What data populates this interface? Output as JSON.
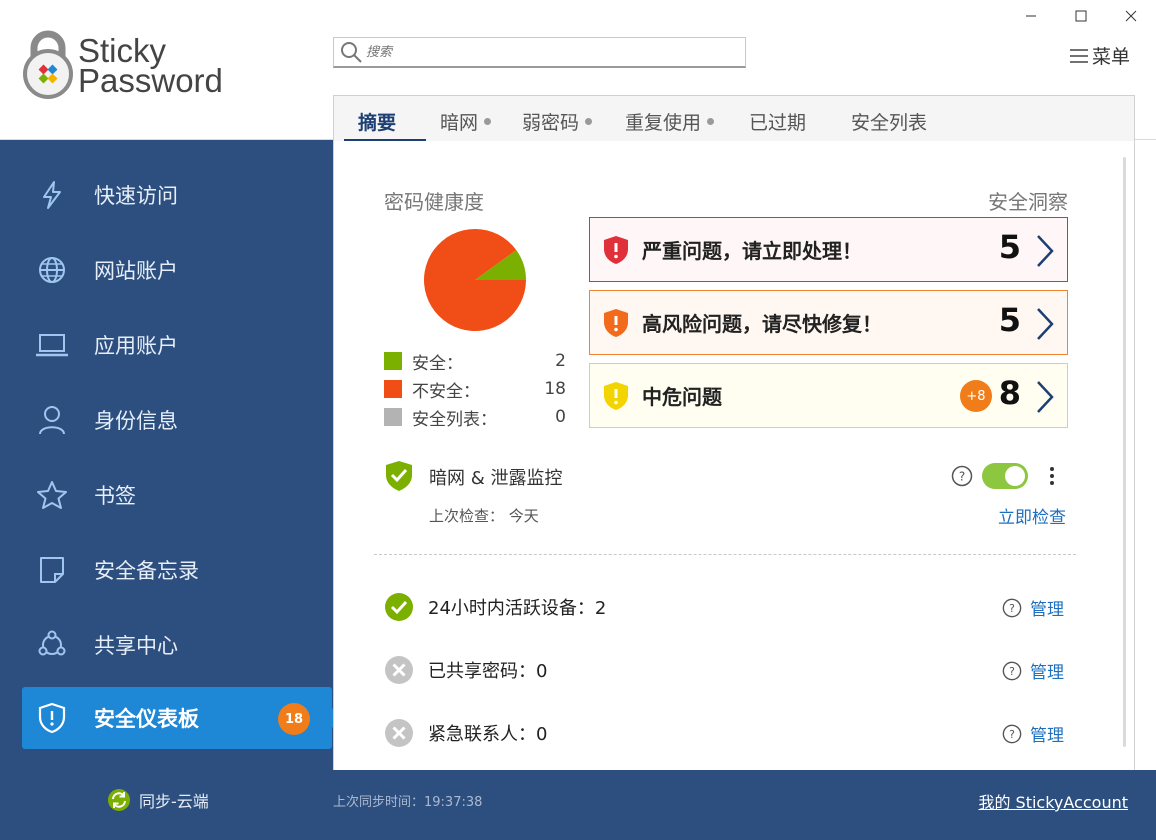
{
  "app": {
    "logo_line1": "Sticky",
    "logo_line2": "Password"
  },
  "search": {
    "placeholder": "搜索"
  },
  "menu": {
    "label": "菜单"
  },
  "tabs": [
    {
      "label": "摘要",
      "active": true,
      "dot": false
    },
    {
      "label": "暗网",
      "dot": true
    },
    {
      "label": "弱密码",
      "dot": true
    },
    {
      "label": "重复使用",
      "dot": true
    },
    {
      "label": "已过期",
      "dot": false
    },
    {
      "label": "安全列表",
      "dot": false
    }
  ],
  "sidebar": {
    "items": [
      {
        "label": "快速访问",
        "icon": "lightning-icon"
      },
      {
        "label": "网站账户",
        "icon": "globe-icon"
      },
      {
        "label": "应用账户",
        "icon": "laptop-icon"
      },
      {
        "label": "身份信息",
        "icon": "person-icon"
      },
      {
        "label": "书签",
        "icon": "star-icon"
      },
      {
        "label": "安全备忘录",
        "icon": "note-icon"
      },
      {
        "label": "共享中心",
        "icon": "share-icon"
      },
      {
        "label": "安全仪表板",
        "icon": "shield-icon",
        "active": true,
        "badge": "18"
      }
    ],
    "sync_label": "同步-云端"
  },
  "footer": {
    "last_sync": "上次同步时间：19:37:38",
    "my_account": "我的 StickyAccount"
  },
  "health": {
    "title": "密码健康度",
    "legend": [
      {
        "label": "安全：",
        "value": "2",
        "color": "#7cb000"
      },
      {
        "label": "不安全：",
        "value": "18",
        "color": "#f04e16"
      },
      {
        "label": "安全列表：",
        "value": "0",
        "color": "#b3b3b3"
      }
    ]
  },
  "insights": {
    "title": "安全洞察",
    "cards": [
      {
        "label": "严重问题，请立即处理！",
        "count": "5",
        "color": "#e0303a",
        "bg": "#fff7f7",
        "border": "#d9313b"
      },
      {
        "label": "高风险问题，请尽快修复！",
        "count": "5",
        "color": "#f26b1d",
        "bg": "#fff8f2",
        "border": "#f08230"
      },
      {
        "label": "中危问题",
        "count": "8",
        "plus": "+8",
        "color": "#f2d400",
        "bg": "#fffef0",
        "border": "#f0d832"
      }
    ]
  },
  "darkweb": {
    "label": "暗网 & 泄露监控",
    "last_check": "上次检查：  今天",
    "check_now": "立即检查",
    "enabled": true
  },
  "status": [
    {
      "label": "24小时内活跃设备：2",
      "ok": true,
      "manage": "管理"
    },
    {
      "label": "已共享密码：0",
      "ok": false,
      "manage": "管理"
    },
    {
      "label": "紧急联系人：0",
      "ok": false,
      "manage": "管理"
    }
  ],
  "chart_data": {
    "type": "pie",
    "categories": [
      "安全：",
      "不安全：",
      "安全列表："
    ],
    "values": [
      2,
      18,
      0
    ],
    "colors": [
      "#7cb000",
      "#f04e16",
      "#b3b3b3"
    ],
    "title": "密码健康度"
  }
}
